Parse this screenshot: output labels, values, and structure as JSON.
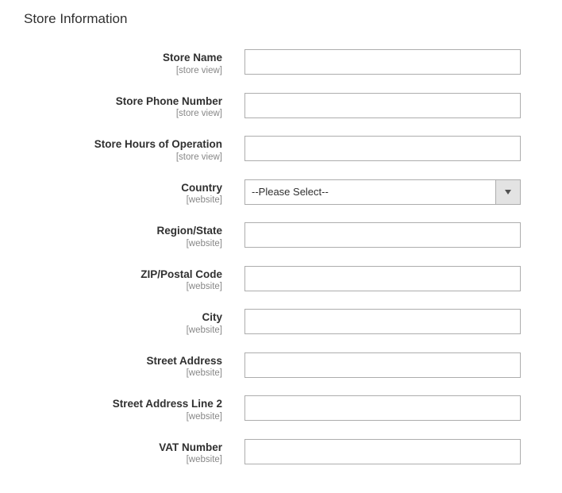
{
  "section_title": "Store Information",
  "fields": {
    "store_name": {
      "label": "Store Name",
      "scope": "[store view]",
      "value": ""
    },
    "store_phone": {
      "label": "Store Phone Number",
      "scope": "[store view]",
      "value": ""
    },
    "store_hours": {
      "label": "Store Hours of Operation",
      "scope": "[store view]",
      "value": ""
    },
    "country": {
      "label": "Country",
      "scope": "[website]",
      "selected": "--Please Select--"
    },
    "region": {
      "label": "Region/State",
      "scope": "[website]",
      "value": ""
    },
    "zip": {
      "label": "ZIP/Postal Code",
      "scope": "[website]",
      "value": ""
    },
    "city": {
      "label": "City",
      "scope": "[website]",
      "value": ""
    },
    "street1": {
      "label": "Street Address",
      "scope": "[website]",
      "value": ""
    },
    "street2": {
      "label": "Street Address Line 2",
      "scope": "[website]",
      "value": ""
    },
    "vat": {
      "label": "VAT Number",
      "scope": "[website]",
      "value": ""
    }
  }
}
